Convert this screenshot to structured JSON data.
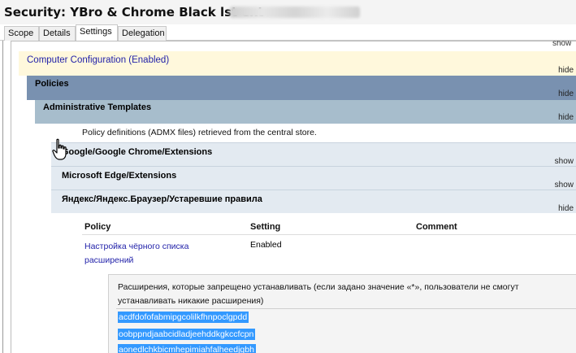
{
  "window": {
    "title": "Security: YBro & Chrome Black lst ext -"
  },
  "tabs": [
    {
      "label": "Scope",
      "active": false
    },
    {
      "label": "Details",
      "active": false
    },
    {
      "label": "Settings",
      "active": true
    },
    {
      "label": "Delegation",
      "active": false
    }
  ],
  "report": {
    "top_toggle": "show",
    "computer_config": {
      "label": "Computer Configuration (Enabled)",
      "toggle": "hide"
    },
    "policies": {
      "label": "Policies",
      "toggle": "hide"
    },
    "admin_templates": {
      "label": "Administrative Templates",
      "toggle": "hide",
      "description": "Policy definitions (ADMX files) retrieved from the central store."
    },
    "categories": [
      {
        "label": "Google/Google Chrome/Extensions",
        "toggle": "show"
      },
      {
        "label": "Microsoft Edge/Extensions",
        "toggle": "show"
      },
      {
        "label": "Яндекс/Яндекс.Браузер/Устаревшие правила",
        "toggle": "hide"
      }
    ],
    "table": {
      "headers": {
        "policy": "Policy",
        "setting": "Setting",
        "comment": "Comment"
      },
      "rows": [
        {
          "policy": "Настройка чёрного списка расширений",
          "setting": "Enabled",
          "comment": ""
        }
      ]
    },
    "list": {
      "description": "Расширения, которые запрещено устанавливать (если задано значение «*», пользователи не смогут устанавливать никакие расширения)",
      "items": [
        "acdfdofofabmipgcolilkfhnpoclgpdd",
        "oobppndjaabcidladjeehddkgkccfcpn",
        "aonedlchkbicmhepimiahfalheedjgbh"
      ]
    }
  },
  "colors": {
    "computer_config_bg": "#fff8dc",
    "policies_bg": "#7991b0",
    "admin_templates_bg": "#a7bdcc",
    "category_bg": "#e3eaf1",
    "link": "#1f1fa8",
    "selection": "#3399ff"
  }
}
